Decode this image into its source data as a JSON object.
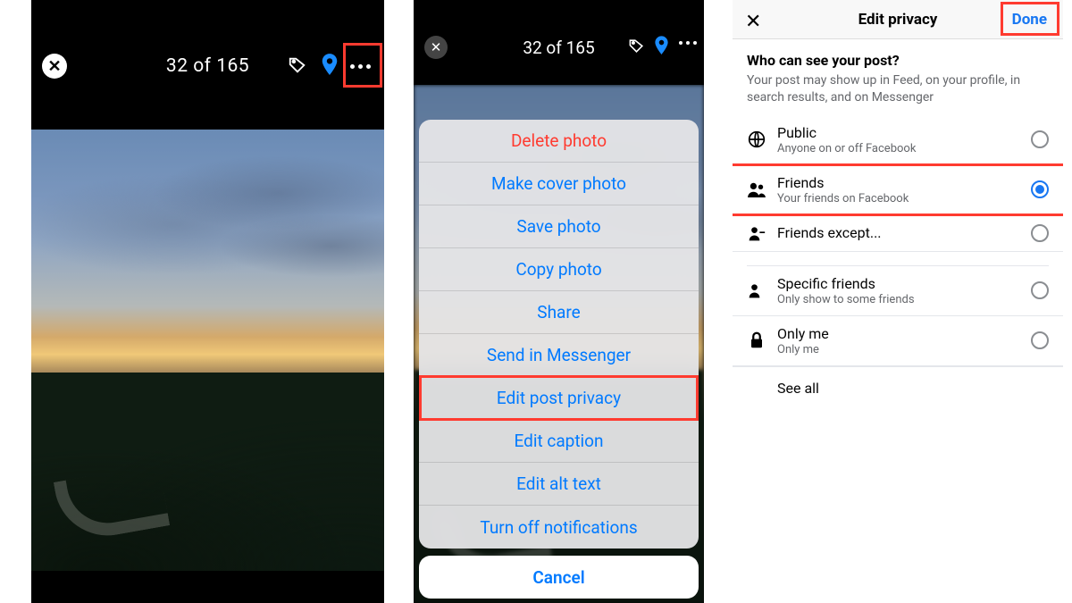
{
  "phone1": {
    "counter": "32 of 165"
  },
  "phone2": {
    "counter": "32 of 165",
    "menu": {
      "delete": "Delete photo",
      "make_cover": "Make cover photo",
      "save": "Save photo",
      "copy": "Copy photo",
      "share": "Share",
      "messenger": "Send in Messenger",
      "edit_privacy": "Edit post privacy",
      "edit_caption": "Edit caption",
      "edit_alt": "Edit alt text",
      "turn_off": "Turn off notifications",
      "cancel": "Cancel"
    }
  },
  "phone3": {
    "header": {
      "title": "Edit privacy",
      "done": "Done"
    },
    "subheading": {
      "title": "Who can see your post?",
      "desc": "Your post may show up in Feed, on your profile, in search results, and on Messenger"
    },
    "options": {
      "public": {
        "title": "Public",
        "desc": "Anyone on or off Facebook"
      },
      "friends": {
        "title": "Friends",
        "desc": "Your friends on Facebook"
      },
      "friends_except": {
        "title": "Friends except..."
      },
      "specific": {
        "title": "Specific friends",
        "desc": "Only show to some friends"
      },
      "only_me": {
        "title": "Only me",
        "desc": "Only me"
      }
    },
    "see_all": "See all",
    "selected": "friends"
  }
}
